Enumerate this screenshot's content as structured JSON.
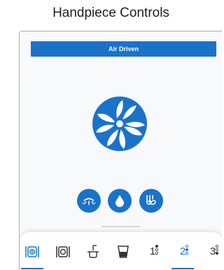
{
  "title": "Handpiece Controls",
  "banner": {
    "label": "Air Driven",
    "color": "#1a73c9"
  },
  "main_icon": "air-fan-icon",
  "controls": [
    {
      "icon": "light-icon"
    },
    {
      "icon": "water-drop-icon"
    },
    {
      "icon": "air-swirl-icon"
    }
  ],
  "tabs": [
    {
      "icon": "air-driven-tab-icon",
      "active": true
    },
    {
      "icon": "electric-tab-icon",
      "active": false
    },
    {
      "icon": "cup-fill-tab-icon",
      "active": false
    },
    {
      "icon": "cup-tab-icon",
      "active": false
    },
    {
      "label": "1",
      "active": false
    },
    {
      "label": "2",
      "active": true
    },
    {
      "label": "3",
      "active": false
    }
  ]
}
